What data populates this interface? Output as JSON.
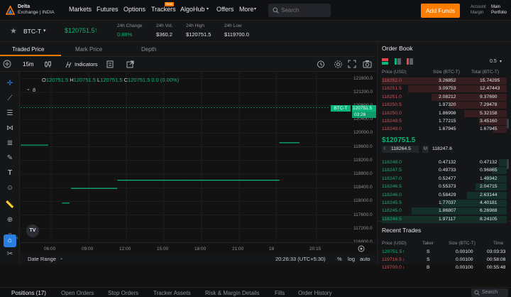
{
  "nav": {
    "brand_line1": "Delta",
    "brand_line2": "Exchange | INDIA",
    "items": [
      "Markets",
      "Futures",
      "Options",
      "Trackers",
      "AlgoHub",
      "Offers",
      "More"
    ],
    "new_badge": "New",
    "search_placeholder": "Search",
    "add_funds": "Add Funds",
    "account_label": "Account",
    "account_value": "Main",
    "margin_label": "Margin",
    "margin_value": "Portfolio"
  },
  "ticker": {
    "symbol": "BTC-T",
    "price": "$120751.5",
    "change_label": "24h Change",
    "change_value": "0.88%",
    "vol_label": "24h Vol.",
    "vol_value": "$360.2",
    "high_label": "24h High",
    "high_value": "$120751.5",
    "low_label": "24h Low",
    "low_value": "$119700.0"
  },
  "chart_tabs": [
    "Traded Price",
    "Mark Price",
    "Depth"
  ],
  "chart_toolbar": {
    "interval": "15m",
    "indicators": "Indicators"
  },
  "ohlc": {
    "o_label": "O",
    "o_value": "120751.5",
    "h_label": "H",
    "h_value": "120751.5",
    "l_label": "L",
    "l_value": "120751.5",
    "c_label": "C",
    "c_value": "120751.5",
    "change": "0.0 (0.00%)",
    "sub_count": "8"
  },
  "price_tag": {
    "symbol": "BTC-T",
    "price": "120751.5",
    "countdown": "03:26"
  },
  "colors": {
    "accent": "#fd7d02",
    "up": "#0bb47a",
    "down": "#e5484d",
    "highlight": "#2a7de1"
  },
  "chart_data": {
    "type": "line",
    "x_ticks": [
      "06:00",
      "09:00",
      "12:00",
      "15:00",
      "18:00",
      "21:00",
      "18",
      "20:15"
    ],
    "y_ticks": [
      "121600.0",
      "121200.0",
      "120800.0",
      "120400.0",
      "120000.0",
      "119600.0",
      "119200.0",
      "118800.0",
      "118400.0",
      "118000.0",
      "117600.0",
      "117200.0",
      "116800.0"
    ],
    "ylim": [
      116800,
      121800
    ],
    "segments": [
      {
        "x": [
          0.0,
          2.2
        ],
        "y": 119650
      },
      {
        "x": [
          3.3,
          3.9
        ],
        "y": 117950
      },
      {
        "x": [
          4.0,
          7.7
        ],
        "y": 118380
      },
      {
        "x": [
          7.7,
          13.0
        ],
        "y": 118620
      },
      {
        "x": [
          13.0,
          20.6
        ],
        "y": 118620
      },
      {
        "x": [
          20.6,
          22.2
        ],
        "y": 119720
      },
      {
        "x": [
          0.0,
          24.5
        ],
        "y": 120751.5
      }
    ]
  },
  "chart_footer": {
    "date_range": "Date Range",
    "time": "20:26:33 (UTC+5:30)",
    "percent": "%",
    "log": "log",
    "auto": "auto"
  },
  "orderbook": {
    "title": "Order Book",
    "step": "0.5",
    "col_price": "Price (USD)",
    "col_size": "Size (BTC-T)",
    "col_total": "Total (BTC-T)",
    "asks": [
      {
        "price": "118252.0",
        "size": "3.26852",
        "total": "15.74295",
        "depth": 1.0
      },
      {
        "price": "118251.5",
        "size": "3.09753",
        "total": "12.47443",
        "depth": 0.79
      },
      {
        "price": "118251.0",
        "size": "2.08212",
        "total": "9.37690",
        "depth": 0.6
      },
      {
        "price": "118250.5",
        "size": "1.97320",
        "total": "7.29478",
        "depth": 0.46
      },
      {
        "price": "118250.0",
        "size": "1.86998",
        "total": "5.32158",
        "depth": 0.34
      },
      {
        "price": "118249.5",
        "size": "1.77215",
        "total": "3.45160",
        "depth": 0.22
      },
      {
        "price": "118249.0",
        "size": "1.67945",
        "total": "1.67945",
        "depth": 0.11
      }
    ],
    "last_price": "$120751.5",
    "index_label": "I",
    "index_price": "118264.5",
    "mark_label": "M",
    "mark_price": "118247.6",
    "bids": [
      {
        "price": "118248.0",
        "size": "0.47132",
        "total": "0.47132",
        "depth": 0.06
      },
      {
        "price": "118247.5",
        "size": "0.49733",
        "total": "0.96865",
        "depth": 0.12
      },
      {
        "price": "118247.0",
        "size": "0.52477",
        "total": "1.49342",
        "depth": 0.18
      },
      {
        "price": "118246.5",
        "size": "0.55373",
        "total": "2.04715",
        "depth": 0.25
      },
      {
        "price": "118246.0",
        "size": "0.58429",
        "total": "2.63144",
        "depth": 0.32
      },
      {
        "price": "118245.5",
        "size": "1.77037",
        "total": "4.40181",
        "depth": 0.53
      },
      {
        "price": "118245.0",
        "size": "1.86807",
        "total": "6.26988",
        "depth": 0.76
      },
      {
        "price": "118244.5",
        "size": "1.97117",
        "total": "8.24105",
        "depth": 1.0
      }
    ]
  },
  "recent_trades": {
    "title": "Recent Trades",
    "col_price": "Price (USD)",
    "col_taker": "Taker",
    "col_size": "Size (BTC-T)",
    "col_time": "Time",
    "rows": [
      {
        "price": "120751.5",
        "arrow": "↑",
        "taker": "S",
        "size": "0.00100",
        "time": "03:03:33",
        "side": "up"
      },
      {
        "price": "119716.5",
        "arrow": "↓",
        "taker": "S",
        "size": "0.00100",
        "time": "00:58:08",
        "side": "down"
      },
      {
        "price": "119700.0",
        "arrow": "↓",
        "taker": "B",
        "size": "0.00100",
        "time": "00:55:48",
        "side": "down"
      }
    ]
  },
  "bottom_tabs": [
    "Positions (17)",
    "Open Orders",
    "Stop Orders",
    "Tracker Assets",
    "Risk & Margin Details",
    "Fills",
    "Order History"
  ],
  "bottom_search_placeholder": "Search"
}
